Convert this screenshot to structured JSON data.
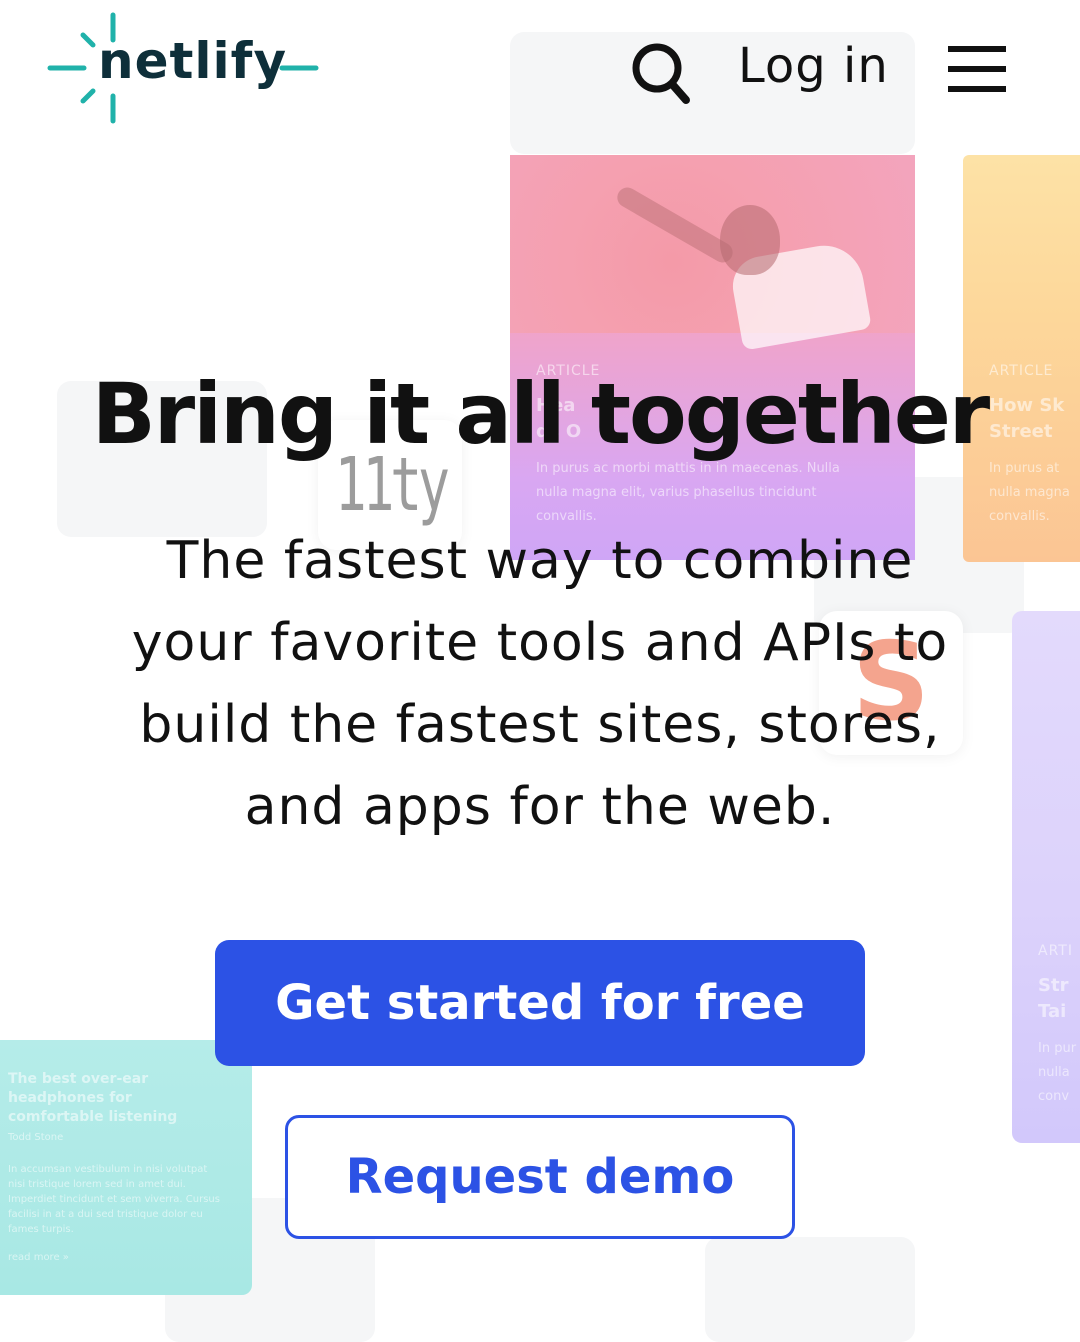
{
  "brand": {
    "name": "netlify",
    "colors": {
      "teal": "#20b2aa",
      "dark": "#0e2f3a"
    }
  },
  "header": {
    "search_icon": "search-icon",
    "login_label": "Log in",
    "menu_icon": "hamburger-menu-icon"
  },
  "hero": {
    "headline": "Bring it all together",
    "subhead": "The fastest way to combine your favorite tools and APIs to build the fastest sites, stores, and apps for the web.",
    "primary_cta": "Get started for free",
    "secondary_cta": "Request demo"
  },
  "colors": {
    "primary": "#2c52e5",
    "text": "#111111"
  },
  "background": {
    "cards": [
      {
        "kicker": "ARTICLE",
        "title": "Hea\nds O",
        "body": "In purus ac morbi mattis in in maecenas. Nulla\nnulla magna elit, varius phasellus tincidunt\nconvallis."
      },
      {
        "kicker": "ARTICLE",
        "title": "How Sk\nStreet",
        "body": "In purus at\nnulla magna\nconvallis."
      },
      {
        "kicker": "ARTI",
        "title": "Str\nTai",
        "body": "In pur\nnulla\nconv"
      },
      {
        "kicker": "Todd Stone",
        "title": "The best over-ear\nheadphones for\ncomfortable listening",
        "body": "In accumsan vestibulum in nisi volutpat\nnisi tristique lorem sed in amet dui.\nImperdiet tincidunt et sem viverra. Cursus\nfacilisi in at a dui sed tristique dolor eu\nfames turpis.",
        "link": "read more »"
      }
    ],
    "logos": [
      {
        "name": "11ty",
        "text": "11ty"
      },
      {
        "name": "svelte",
        "text": "S"
      }
    ]
  }
}
